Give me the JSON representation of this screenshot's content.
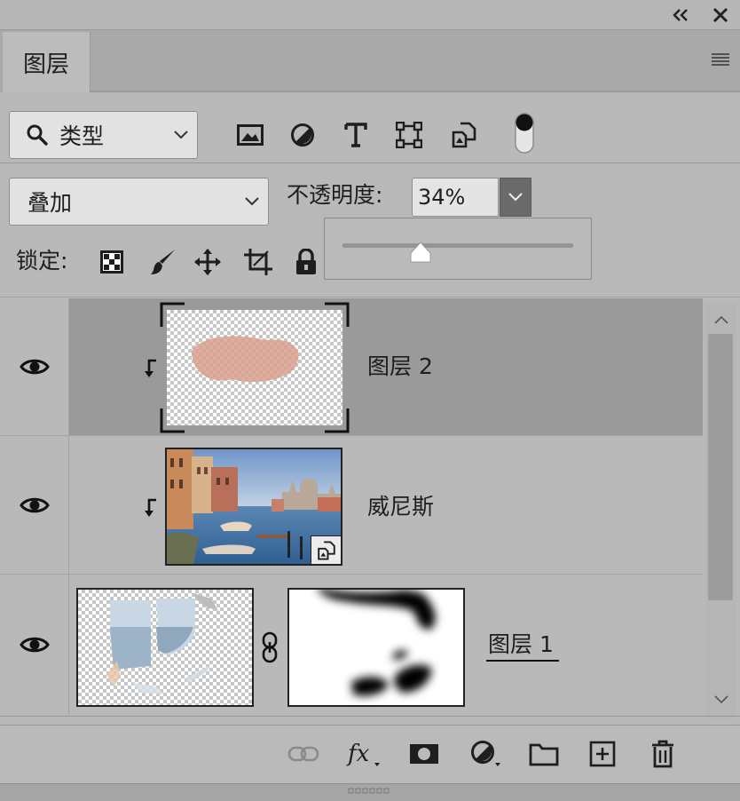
{
  "panel": {
    "tab_label": "图层",
    "filter": {
      "selected": "类型"
    },
    "blend_mode": {
      "selected": "叠加"
    },
    "opacity": {
      "label": "不透明度:",
      "value": "34%",
      "slider_fraction": 0.34
    },
    "lock": {
      "label": "锁定:"
    }
  },
  "layers": [
    {
      "name": "图层 2",
      "selected": true,
      "visible": true,
      "clipped": true,
      "thumbnail": "pink-brush-stroke"
    },
    {
      "name": "威尼斯",
      "selected": false,
      "visible": true,
      "clipped": true,
      "smart_object": true,
      "thumbnail": "venice-canal-photo"
    },
    {
      "name": "图层 1",
      "selected": false,
      "visible": true,
      "clipped": false,
      "has_mask": true,
      "linked_mask": true,
      "thumbnail": "sea-pieces"
    }
  ],
  "colors": {
    "panel_bg": "#b9b9b9",
    "selected_row": "#9a9a9a",
    "dropdown_bg": "#e2e2e2",
    "icon": "#1e1e1e"
  }
}
